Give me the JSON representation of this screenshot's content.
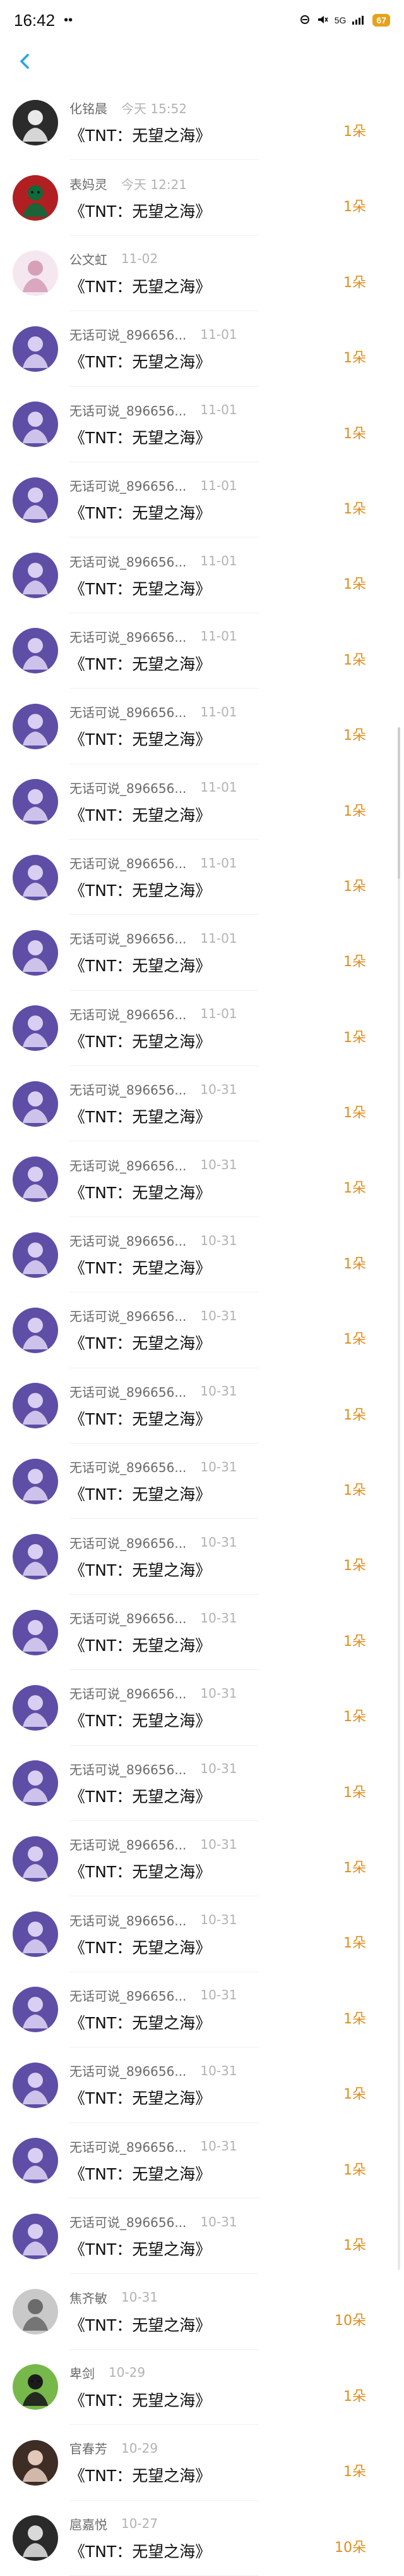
{
  "status": {
    "time": "16:42",
    "dots": "••",
    "right_icons": [
      "dnd-icon",
      "mute-icon",
      "5g-icon",
      "signal-icon"
    ],
    "signal_text": "5G",
    "battery": "67"
  },
  "nav": {
    "back_icon": "chevron-left-icon"
  },
  "items": [
    {
      "name": "化铭晨",
      "time": "今天 15:52",
      "title": "《TNT：无望之海》",
      "reward": "1朵",
      "avatar": {
        "bg": "#2b2b2b",
        "fg": "#e9e9e9",
        "icon": "person-icon"
      }
    },
    {
      "name": "表妈灵",
      "time": "今天 12:21",
      "title": "《TNT：无望之海》",
      "reward": "1朵",
      "avatar": {
        "bg": "#b11f22",
        "fg": "#0c6a3b",
        "icon": "cartoon-icon"
      }
    },
    {
      "name": "公文虹",
      "time": "11-02",
      "title": "《TNT：无望之海》",
      "reward": "1朵",
      "avatar": {
        "bg": "#f5e7ef",
        "fg": "#d7a0b9",
        "icon": "person-icon"
      }
    },
    {
      "name": "无话可说_896656...",
      "time": "11-01",
      "title": "《TNT：无望之海》",
      "reward": "1朵",
      "avatar": {
        "bg": "#5e4ea6",
        "fg": "#d9cff2",
        "icon": "person-icon"
      }
    },
    {
      "name": "无话可说_896656...",
      "time": "11-01",
      "title": "《TNT：无望之海》",
      "reward": "1朵",
      "avatar": {
        "bg": "#5e4ea6",
        "fg": "#d9cff2",
        "icon": "person-icon"
      }
    },
    {
      "name": "无话可说_896656...",
      "time": "11-01",
      "title": "《TNT：无望之海》",
      "reward": "1朵",
      "avatar": {
        "bg": "#5e4ea6",
        "fg": "#d9cff2",
        "icon": "person-icon"
      }
    },
    {
      "name": "无话可说_896656...",
      "time": "11-01",
      "title": "《TNT：无望之海》",
      "reward": "1朵",
      "avatar": {
        "bg": "#5e4ea6",
        "fg": "#d9cff2",
        "icon": "person-icon"
      }
    },
    {
      "name": "无话可说_896656...",
      "time": "11-01",
      "title": "《TNT：无望之海》",
      "reward": "1朵",
      "avatar": {
        "bg": "#5e4ea6",
        "fg": "#d9cff2",
        "icon": "person-icon"
      }
    },
    {
      "name": "无话可说_896656...",
      "time": "11-01",
      "title": "《TNT：无望之海》",
      "reward": "1朵",
      "avatar": {
        "bg": "#5e4ea6",
        "fg": "#d9cff2",
        "icon": "person-icon"
      }
    },
    {
      "name": "无话可说_896656...",
      "time": "11-01",
      "title": "《TNT：无望之海》",
      "reward": "1朵",
      "avatar": {
        "bg": "#5e4ea6",
        "fg": "#d9cff2",
        "icon": "person-icon"
      }
    },
    {
      "name": "无话可说_896656...",
      "time": "11-01",
      "title": "《TNT：无望之海》",
      "reward": "1朵",
      "avatar": {
        "bg": "#5e4ea6",
        "fg": "#d9cff2",
        "icon": "person-icon"
      }
    },
    {
      "name": "无话可说_896656...",
      "time": "11-01",
      "title": "《TNT：无望之海》",
      "reward": "1朵",
      "avatar": {
        "bg": "#5e4ea6",
        "fg": "#d9cff2",
        "icon": "person-icon"
      }
    },
    {
      "name": "无话可说_896656...",
      "time": "11-01",
      "title": "《TNT：无望之海》",
      "reward": "1朵",
      "avatar": {
        "bg": "#5e4ea6",
        "fg": "#d9cff2",
        "icon": "person-icon"
      }
    },
    {
      "name": "无话可说_896656...",
      "time": "10-31",
      "title": "《TNT：无望之海》",
      "reward": "1朵",
      "avatar": {
        "bg": "#5e4ea6",
        "fg": "#d9cff2",
        "icon": "person-icon"
      }
    },
    {
      "name": "无话可说_896656...",
      "time": "10-31",
      "title": "《TNT：无望之海》",
      "reward": "1朵",
      "avatar": {
        "bg": "#5e4ea6",
        "fg": "#d9cff2",
        "icon": "person-icon"
      }
    },
    {
      "name": "无话可说_896656...",
      "time": "10-31",
      "title": "《TNT：无望之海》",
      "reward": "1朵",
      "avatar": {
        "bg": "#5e4ea6",
        "fg": "#d9cff2",
        "icon": "person-icon"
      }
    },
    {
      "name": "无话可说_896656...",
      "time": "10-31",
      "title": "《TNT：无望之海》",
      "reward": "1朵",
      "avatar": {
        "bg": "#5e4ea6",
        "fg": "#d9cff2",
        "icon": "person-icon"
      }
    },
    {
      "name": "无话可说_896656...",
      "time": "10-31",
      "title": "《TNT：无望之海》",
      "reward": "1朵",
      "avatar": {
        "bg": "#5e4ea6",
        "fg": "#d9cff2",
        "icon": "person-icon"
      }
    },
    {
      "name": "无话可说_896656...",
      "time": "10-31",
      "title": "《TNT：无望之海》",
      "reward": "1朵",
      "avatar": {
        "bg": "#5e4ea6",
        "fg": "#d9cff2",
        "icon": "person-icon"
      }
    },
    {
      "name": "无话可说_896656...",
      "time": "10-31",
      "title": "《TNT：无望之海》",
      "reward": "1朵",
      "avatar": {
        "bg": "#5e4ea6",
        "fg": "#d9cff2",
        "icon": "person-icon"
      }
    },
    {
      "name": "无话可说_896656...",
      "time": "10-31",
      "title": "《TNT：无望之海》",
      "reward": "1朵",
      "avatar": {
        "bg": "#5e4ea6",
        "fg": "#d9cff2",
        "icon": "person-icon"
      }
    },
    {
      "name": "无话可说_896656...",
      "time": "10-31",
      "title": "《TNT：无望之海》",
      "reward": "1朵",
      "avatar": {
        "bg": "#5e4ea6",
        "fg": "#d9cff2",
        "icon": "person-icon"
      }
    },
    {
      "name": "无话可说_896656...",
      "time": "10-31",
      "title": "《TNT：无望之海》",
      "reward": "1朵",
      "avatar": {
        "bg": "#5e4ea6",
        "fg": "#d9cff2",
        "icon": "person-icon"
      }
    },
    {
      "name": "无话可说_896656...",
      "time": "10-31",
      "title": "《TNT：无望之海》",
      "reward": "1朵",
      "avatar": {
        "bg": "#5e4ea6",
        "fg": "#d9cff2",
        "icon": "person-icon"
      }
    },
    {
      "name": "无话可说_896656...",
      "time": "10-31",
      "title": "《TNT：无望之海》",
      "reward": "1朵",
      "avatar": {
        "bg": "#5e4ea6",
        "fg": "#d9cff2",
        "icon": "person-icon"
      }
    },
    {
      "name": "无话可说_896656...",
      "time": "10-31",
      "title": "《TNT：无望之海》",
      "reward": "1朵",
      "avatar": {
        "bg": "#5e4ea6",
        "fg": "#d9cff2",
        "icon": "person-icon"
      }
    },
    {
      "name": "无话可说_896656...",
      "time": "10-31",
      "title": "《TNT：无望之海》",
      "reward": "1朵",
      "avatar": {
        "bg": "#5e4ea6",
        "fg": "#d9cff2",
        "icon": "person-icon"
      }
    },
    {
      "name": "无话可说_896656...",
      "time": "10-31",
      "title": "《TNT：无望之海》",
      "reward": "1朵",
      "avatar": {
        "bg": "#5e4ea6",
        "fg": "#d9cff2",
        "icon": "person-icon"
      }
    },
    {
      "name": "无话可说_896656...",
      "time": "10-31",
      "title": "《TNT：无望之海》",
      "reward": "1朵",
      "avatar": {
        "bg": "#5e4ea6",
        "fg": "#d9cff2",
        "icon": "person-icon"
      }
    },
    {
      "name": "焦齐敏",
      "time": "10-31",
      "title": "《TNT：无望之海》",
      "reward": "10朵",
      "avatar": {
        "bg": "#c9c9c9",
        "fg": "#6b6b6b",
        "icon": "person-icon"
      }
    },
    {
      "name": "卑剑",
      "time": "10-29",
      "title": "《TNT：无望之海》",
      "reward": "1朵",
      "avatar": {
        "bg": "#77b84a",
        "fg": "#1b1b1b",
        "icon": "cartoon-icon"
      }
    },
    {
      "name": "官春芳",
      "time": "10-29",
      "title": "《TNT：无望之海》",
      "reward": "1朵",
      "avatar": {
        "bg": "#3d2d25",
        "fg": "#e1c8b9",
        "icon": "person-icon"
      }
    },
    {
      "name": "扈嘉悦",
      "time": "10-27",
      "title": "《TNT：无望之海》",
      "reward": "10朵",
      "avatar": {
        "bg": "#2a2a2a",
        "fg": "#d9d9d9",
        "icon": "person-icon"
      }
    }
  ],
  "colors": {
    "reward": "#e38c1c",
    "back": "#21a6e8",
    "meta": "#8a8a8a"
  }
}
